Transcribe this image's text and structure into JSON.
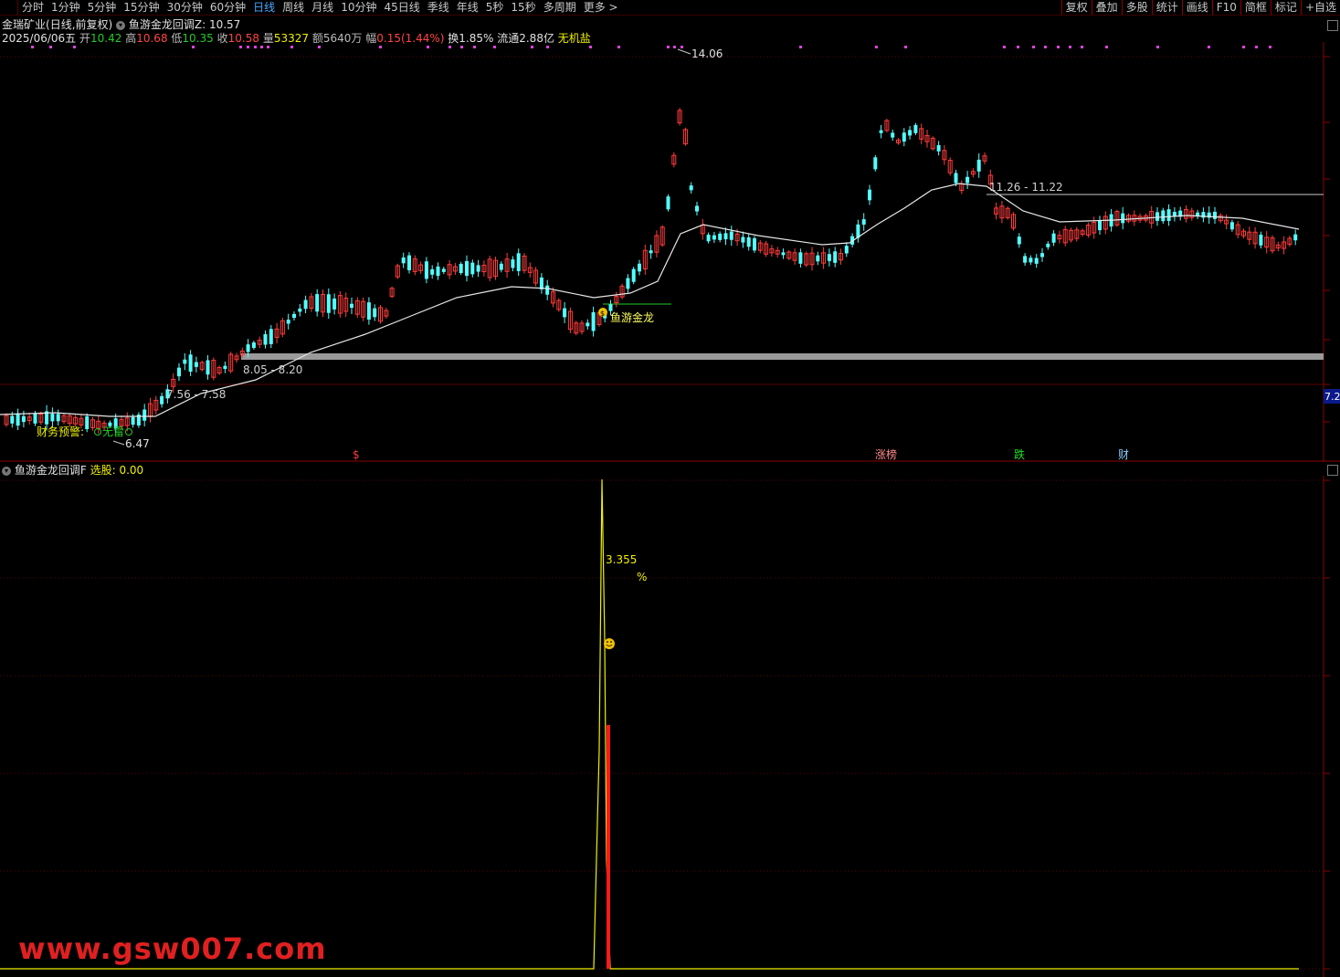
{
  "toolbar": {
    "periods": [
      "分时",
      "1分钟",
      "5分钟",
      "15分钟",
      "30分钟",
      "60分钟",
      "日线",
      "周线",
      "月线",
      "10分钟",
      "45日线",
      "季线",
      "年线",
      "5秒",
      "15秒",
      "多周期",
      "更多 >"
    ],
    "active_period": "日线",
    "right_buttons": [
      "复权",
      "叠加",
      "多股",
      "统计",
      "画线",
      "F10",
      "简框",
      "标记",
      "+自选"
    ]
  },
  "header": {
    "stock_name": "金瑞矿业",
    "chart_mode": "(日线,前复权)",
    "indicator_name": "鱼游金龙回调Z",
    "indicator_value": ": 10.57",
    "date": "2025/06/06五",
    "open_label": "开",
    "open": "10.42",
    "high_label": "高",
    "high": "10.68",
    "low_label": "低",
    "low": "10.35",
    "close_label": "收",
    "close": "10.58",
    "volume_label": "量",
    "volume": "53327",
    "amount_label": "额",
    "amount": "5640万",
    "change_label": "幅",
    "change": "0.15(1.44%)",
    "turnover": "换1.85%",
    "float_cap": "流通2.88亿",
    "concept": "无机盐"
  },
  "main_chart": {
    "annotations": {
      "top_price": "14.06",
      "bottom_price": "6.47",
      "zone_lower": "7.56 - 7.58",
      "zone_mid": "8.05 - 8.20",
      "zone_upper": "11.26 - 11.22",
      "signal_label": "鱼游金龙",
      "finance_warning": "财务预警:",
      "finance_none": "无雷",
      "right_axis_price": "7.2"
    },
    "events": [
      "$",
      "涨榜",
      "跌",
      "财"
    ],
    "colors": {
      "up": "#ff3b3b",
      "down": "#54ffff",
      "ma": "#e6e6e6",
      "zone": "#9a9a9a",
      "grid": "#5a0000"
    }
  },
  "indicator_panel": {
    "title": "鱼游金龙回调F",
    "select_label": "选股:",
    "select_value": "0.00",
    "peak_value": "3.355",
    "unit": "%"
  },
  "watermark": "www.gsw007.com"
}
